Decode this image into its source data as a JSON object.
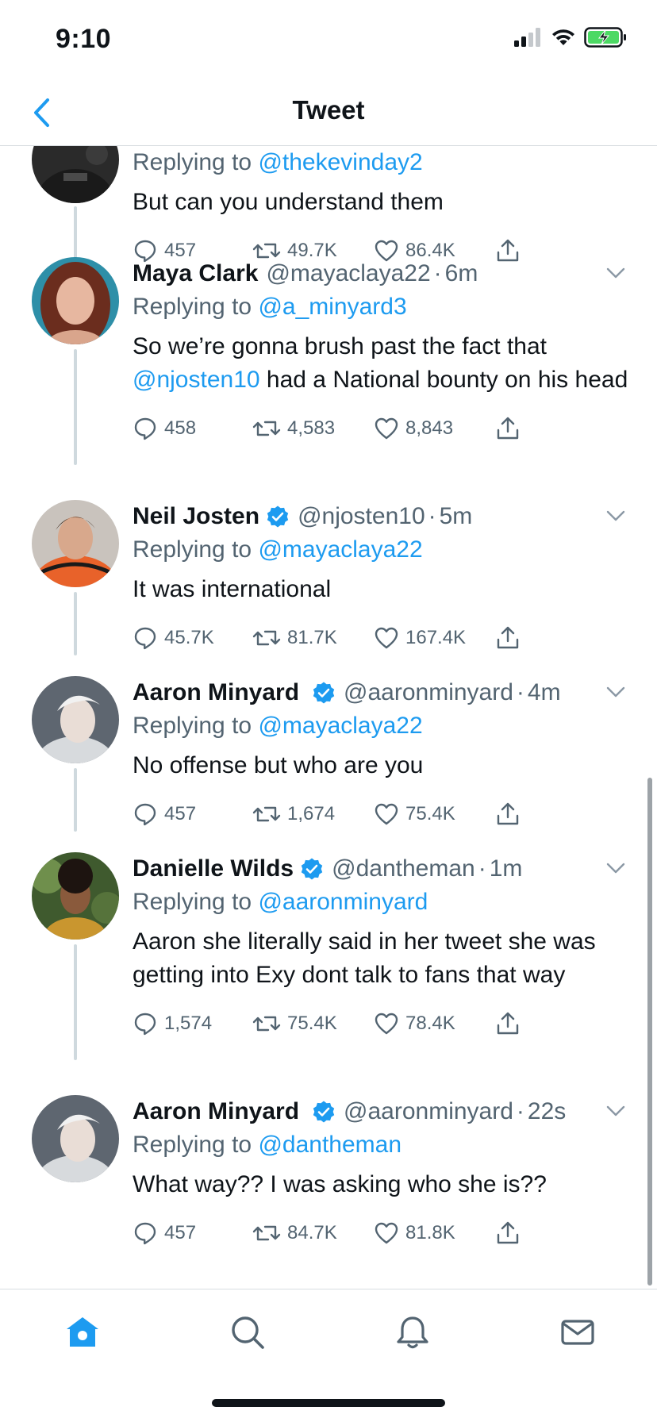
{
  "status": {
    "time": "9:10"
  },
  "header": {
    "title": "Tweet"
  },
  "colors": {
    "accent": "#1d9bf0",
    "muted": "#536471",
    "text": "#0f1419",
    "battery": "#4cd964"
  },
  "tweets": [
    {
      "name": "",
      "handle": "",
      "time": "",
      "verified": false,
      "replying_label": "Replying to",
      "replying_to": "@thekevinday2",
      "text": "But can you understand them",
      "replies": "457",
      "retweets": "49.7K",
      "likes": "86.4K"
    },
    {
      "name": "Maya Clark",
      "handle": "@mayaclaya22",
      "time": "6m",
      "verified": false,
      "replying_label": "Replying to",
      "replying_to": "@a_minyard3",
      "text_before": "So we’re gonna brush past the fact that",
      "text_mention": "@njosten10",
      "text_after": "had a National bounty on his head",
      "replies": "458",
      "retweets": "4,583",
      "likes": "8,843"
    },
    {
      "name": "Neil Josten",
      "handle": "@njosten10",
      "time": "5m",
      "verified": true,
      "replying_label": "Replying to",
      "replying_to": "@mayaclaya22",
      "text": "It was international",
      "replies": "45.7K",
      "retweets": "81.7K",
      "likes": "167.4K"
    },
    {
      "name": "Aaron Minyard",
      "handle": "@aaronminyard",
      "time": "4m",
      "verified": true,
      "replying_label": "Replying to",
      "replying_to": "@mayaclaya22",
      "text": "No offense but who are you",
      "replies": "457",
      "retweets": "1,674",
      "likes": "75.4K"
    },
    {
      "name": "Danielle Wilds",
      "handle": "@dantheman",
      "time": "1m",
      "verified": true,
      "replying_label": "Replying to",
      "replying_to": "@aaronminyard",
      "text": "Aaron she literally said in her tweet she was getting into Exy dont talk to fans that way",
      "replies": "1,574",
      "retweets": "75.4K",
      "likes": "78.4K"
    },
    {
      "name": "Aaron Minyard",
      "handle": "@aaronminyard",
      "time": "22s",
      "verified": true,
      "replying_label": "Replying to",
      "replying_to": "@dantheman",
      "text": "What way?? I was asking who she is??",
      "replies": "457",
      "retweets": "84.7K",
      "likes": "81.8K"
    }
  ],
  "tabs": [
    {
      "icon": "home-icon",
      "active": true
    },
    {
      "icon": "search-icon",
      "active": false
    },
    {
      "icon": "notifications-icon",
      "active": false
    },
    {
      "icon": "messages-icon",
      "active": false
    }
  ]
}
